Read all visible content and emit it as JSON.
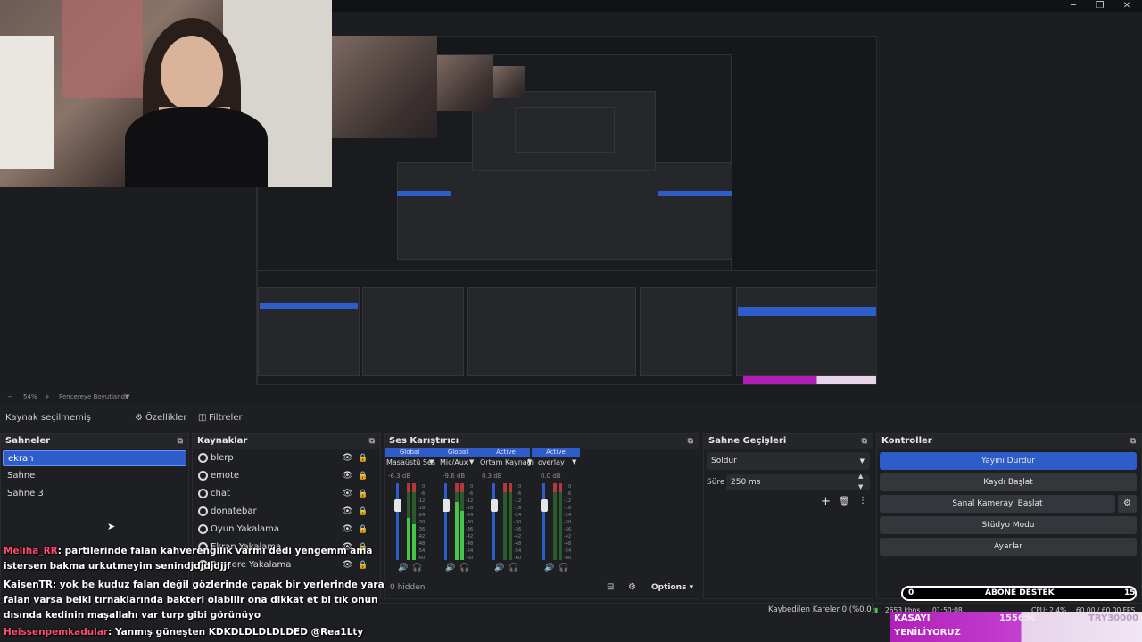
{
  "window": {
    "minimize": "─",
    "restore": "❐",
    "close": "✕"
  },
  "preview_status": {
    "zoom": "54%",
    "mode": "Pencereye Boyutlandır"
  },
  "source_toolbar": {
    "no_source": "Kaynak seçilmemiş",
    "properties": "Özellikler",
    "filters": "Filtreler"
  },
  "scenes": {
    "title": "Sahneler",
    "items": [
      "ekran",
      "Sahne",
      "Sahne 3"
    ],
    "selected": 0
  },
  "sources": {
    "title": "Kaynaklar",
    "items": [
      "blerp",
      "emote",
      "chat",
      "donatebar",
      "Oyun Yakalama",
      "Ekran Yakalama",
      "Pencere Yakalama"
    ]
  },
  "mixer": {
    "title": "Ses Karıştırıcı",
    "channels": [
      {
        "tag": "Global",
        "name": "Masaüstü Ses",
        "db": "-6.3 dB",
        "level": 0.55
      },
      {
        "tag": "Global",
        "name": "Mic/Aux",
        "db": "-9.6 dB",
        "level": 0.75
      },
      {
        "tag": "Active",
        "name": "Ortam Kaynağı",
        "db": "0.3 dB",
        "level": 0.0
      },
      {
        "tag": "Active",
        "name": "overlay",
        "db": "0.0 dB",
        "level": 0.0
      }
    ],
    "scale": [
      "0",
      "-6",
      "-12",
      "-18",
      "-24",
      "-30",
      "-36",
      "-42",
      "-48",
      "-54",
      "-60"
    ],
    "hidden_label": "0 hidden",
    "options_label": "Options"
  },
  "transitions": {
    "title": "Sahne Geçişleri",
    "selected": "Soldur",
    "duration_label": "Süre",
    "duration_value": "250 ms"
  },
  "controls": {
    "title": "Kontroller",
    "buttons": [
      "Yayını Durdur",
      "Kaydı Başlat",
      "Sanal Kamerayı Başlat",
      "Stüdyo Modu",
      "Ayarlar"
    ]
  },
  "chat": {
    "messages": [
      {
        "user": "Meliha_RR",
        "text": ": partilerinde falan kahverengilik varmı dedi yengemm ama"
      },
      {
        "user": "",
        "text": "istersen bakma urkutmeyim senindjdjdjdjjf"
      },
      {
        "user": "KaisenTR",
        "text": ": yok be kuduz falan değil gözlerinde çapak bir yerlerinde yara"
      },
      {
        "user": "",
        "text": "falan varsa belki tırnaklarında bakteri olabilir ona dikkat et bi tık onun"
      },
      {
        "user": "",
        "text": "dısında kedinin maşallahı var turp gibi görünüyo"
      },
      {
        "user": "Heissenpemkadular",
        "text": ": Yanmış güneşten KDKDLDLDLDLDED @Rea1Lty"
      }
    ]
  },
  "status": {
    "dropped": "Kaybedilen Kareler 0 (%0.0)",
    "kbps": "2653 kbps",
    "time": "01:50:08",
    "cpu": "CPU: 2.4%",
    "fps": "60.00 / 60.00 FPS"
  },
  "overlay": {
    "abone_left": "0",
    "abone_title": "ABONE DESTEK",
    "abone_right": "15",
    "kasayi": "KASAYI",
    "yenileniyoruz": "YENİLİYORUZ",
    "kasa_value": "15565€",
    "try_value": "TRY30000"
  },
  "colors": {
    "accent": "#2e5cc8",
    "chat_name": "#ff4d6d",
    "kasa": "#b020b8"
  }
}
